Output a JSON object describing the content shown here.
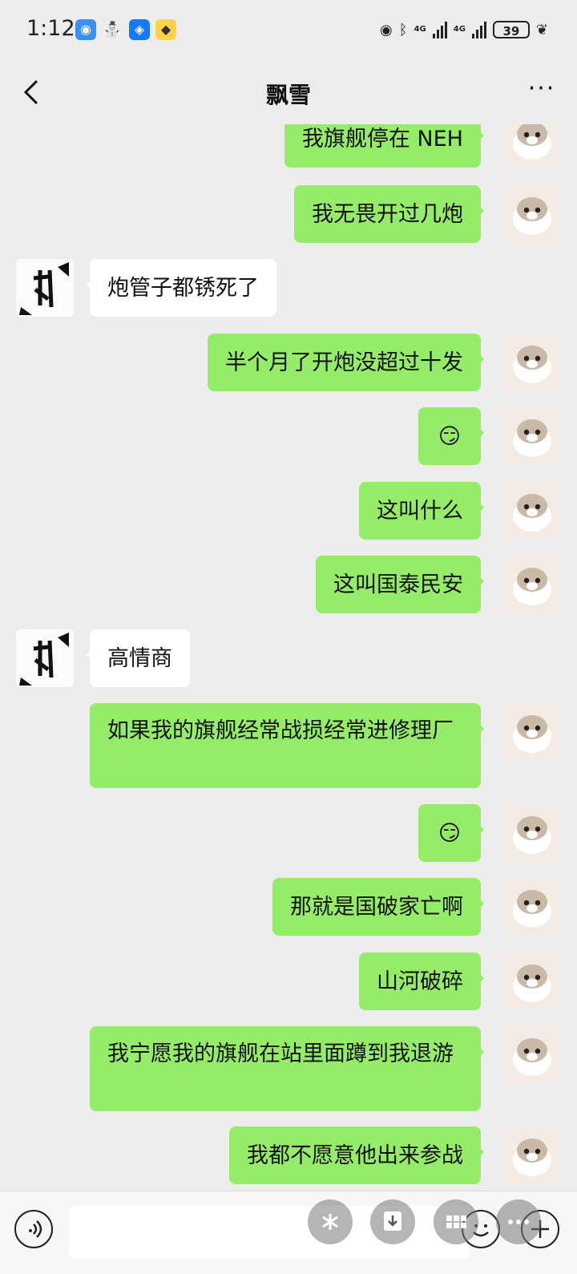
{
  "status": {
    "time": "1:12",
    "network1": "4G",
    "network2": "4G",
    "battery": "39"
  },
  "header": {
    "title": "飘雪",
    "more": "···"
  },
  "messages": [
    {
      "side": "me",
      "text": "我旗舰停在 NEH"
    },
    {
      "side": "me",
      "text": "我无畏开过几炮"
    },
    {
      "side": "them",
      "text": "炮管子都锈死了"
    },
    {
      "side": "me",
      "text": "半个月了开炮没超过十发"
    },
    {
      "side": "me",
      "text": "😏"
    },
    {
      "side": "me",
      "text": "这叫什么"
    },
    {
      "side": "me",
      "text": "这叫国泰民安"
    },
    {
      "side": "them",
      "text": "高情商"
    },
    {
      "side": "me",
      "text": "如果我的旗舰经常战损经常进修理厂"
    },
    {
      "side": "me",
      "text": "😏"
    },
    {
      "side": "me",
      "text": "那就是国破家亡啊"
    },
    {
      "side": "me",
      "text": "山河破碎"
    },
    {
      "side": "me",
      "text": "我宁愿我的旗舰在站里面蹲到我退游"
    },
    {
      "side": "me",
      "text": "我都不愿意他出来参战"
    }
  ],
  "icons": {
    "back": "chevron-left-icon",
    "voice": "voice-icon",
    "emoji": "emoji-icon",
    "plus": "plus-icon"
  }
}
